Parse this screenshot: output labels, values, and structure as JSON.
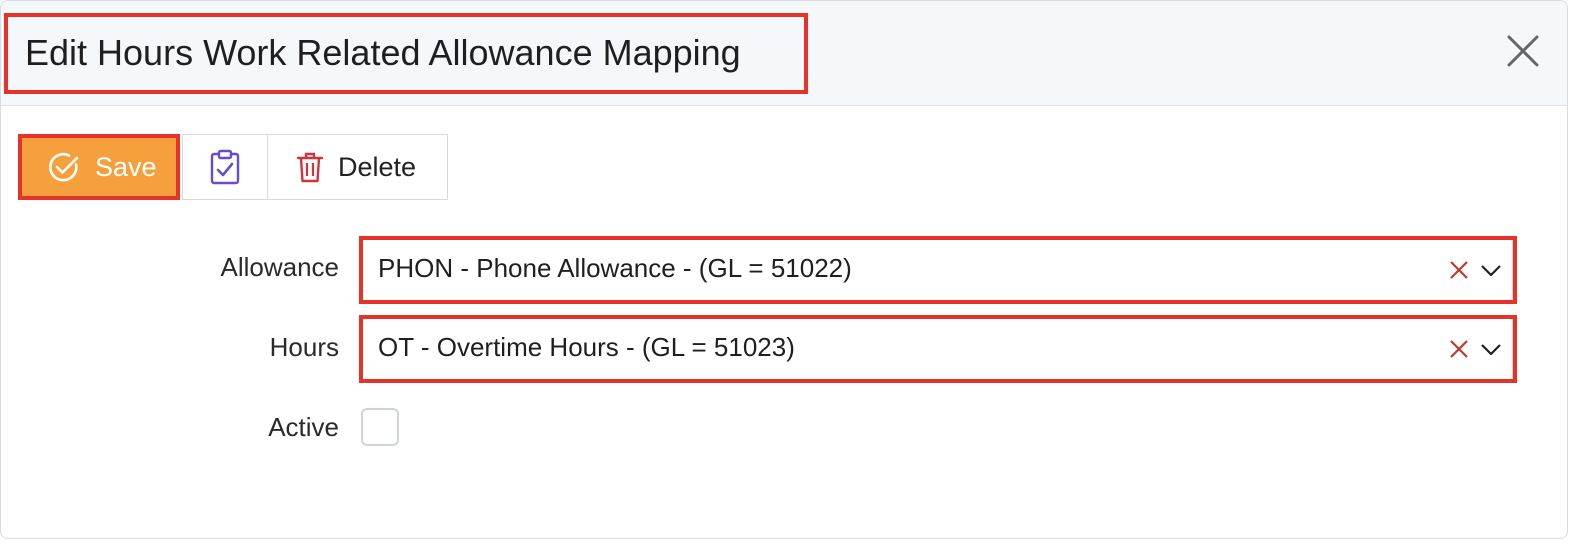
{
  "dialog": {
    "title": "Edit Hours Work Related Allowance Mapping"
  },
  "toolbar": {
    "save_label": "Save",
    "delete_label": "Delete"
  },
  "form": {
    "allowance": {
      "label": "Allowance",
      "value": "PHON - Phone Allowance - (GL = 51022)"
    },
    "hours": {
      "label": "Hours",
      "value": "OT - Overtime Hours - (GL = 51023)"
    },
    "active": {
      "label": "Active",
      "checked": false
    }
  },
  "colors": {
    "accent": "#f5a03c",
    "highlight": "#e5332a",
    "clipboard_icon": "#6a4ad1",
    "delete_icon": "#d0353f",
    "clear_icon": "#c0392b"
  },
  "icons": {
    "close": "close-icon",
    "save": "check-circle-icon",
    "clipboard": "clipboard-check-icon",
    "delete": "trash-icon",
    "clear": "clear-x-icon",
    "dropdown": "chevron-down-icon"
  }
}
